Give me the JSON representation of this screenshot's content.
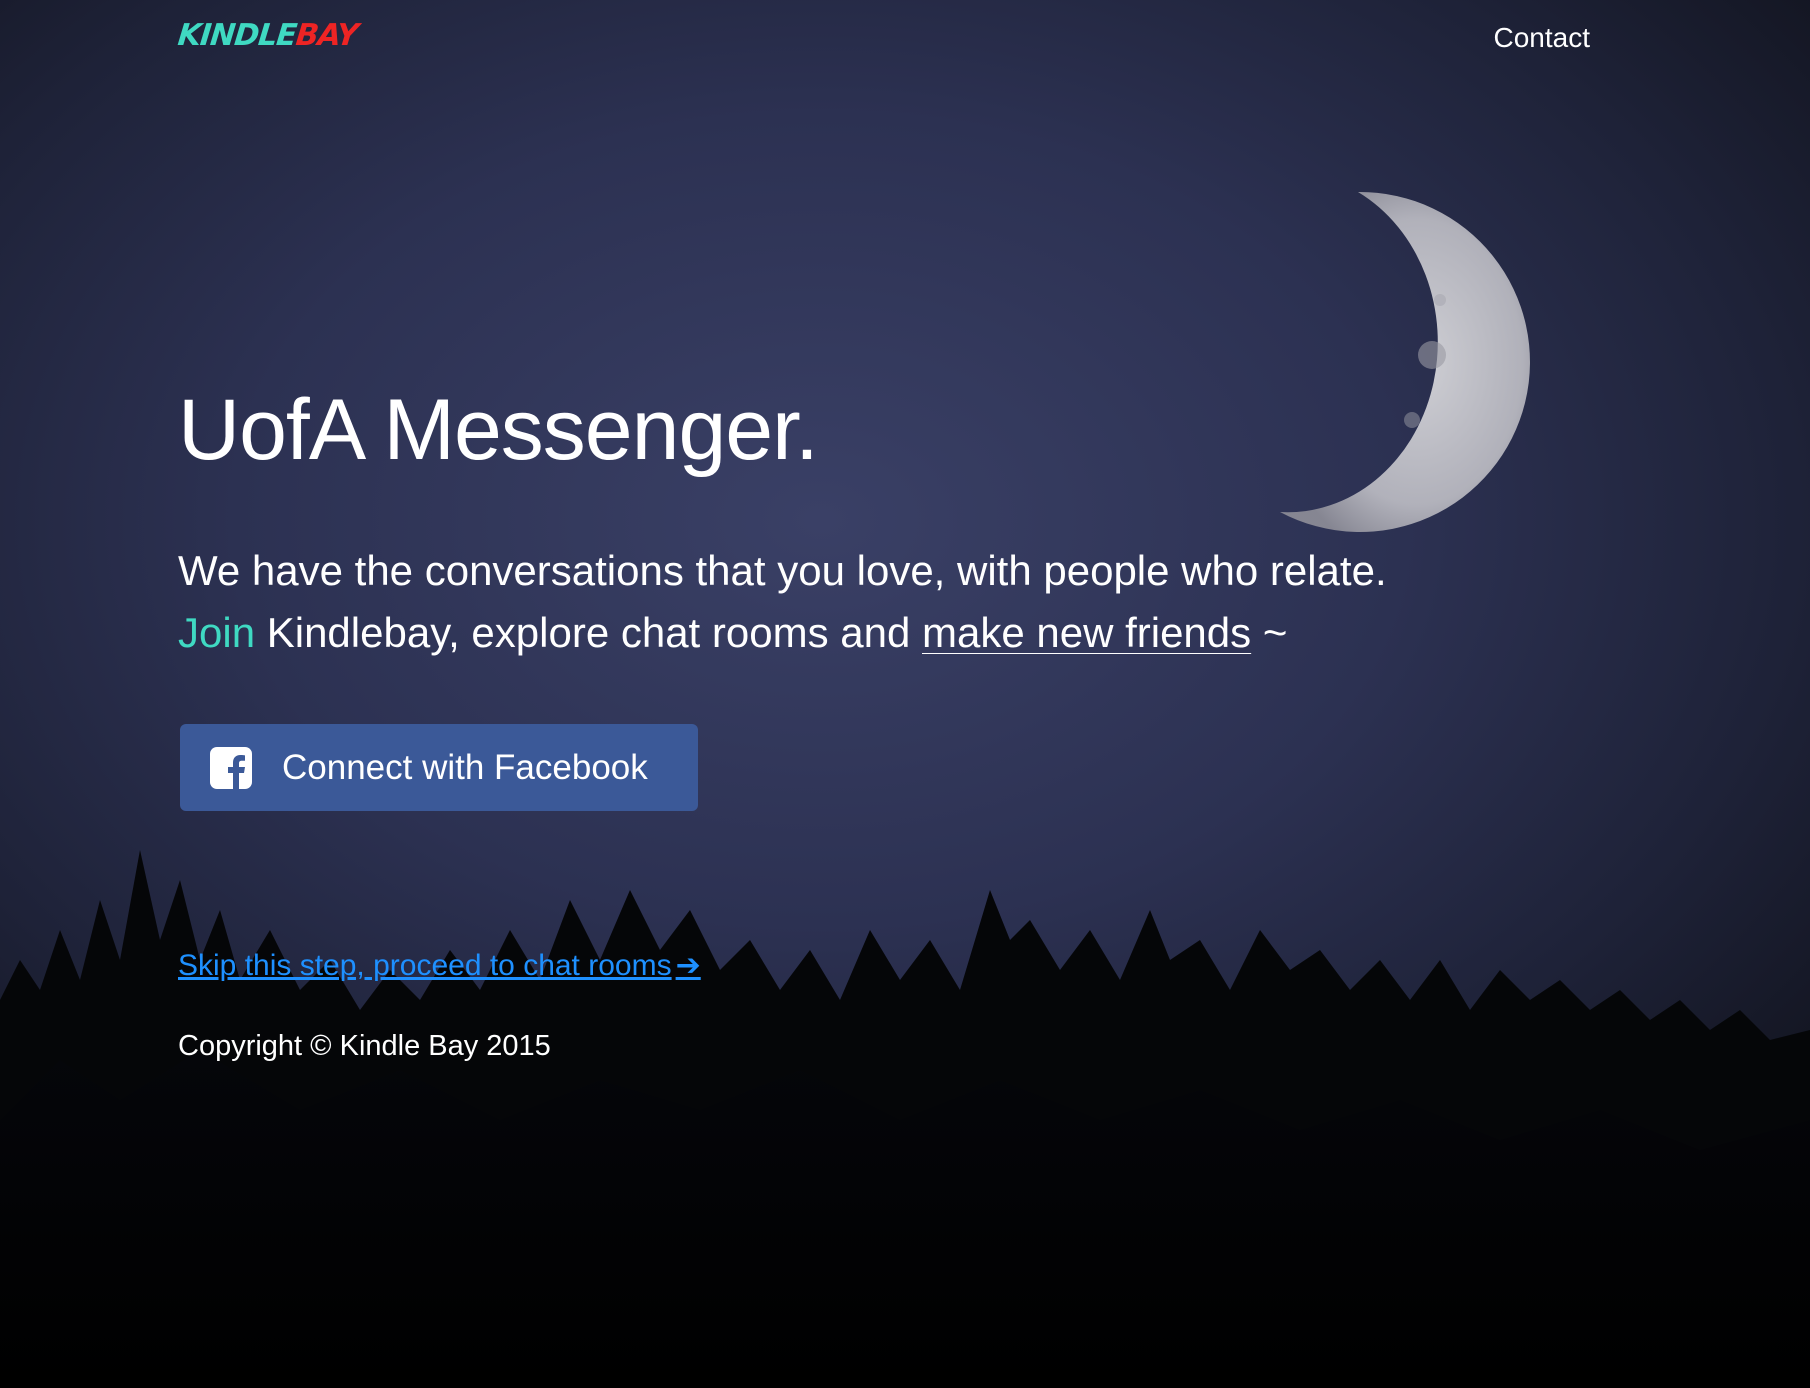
{
  "nav": {
    "logo_part1": "KINDLE",
    "logo_part2": "BAY",
    "contact_label": "Contact"
  },
  "hero": {
    "title": "UofA Messenger.",
    "tagline_line1": "We have the conversations that you love, with people who relate.",
    "tagline_join": "Join",
    "tagline_middle": " Kindlebay, explore chat rooms and ",
    "tagline_friends": "make new friends",
    "tagline_end": " ~"
  },
  "cta": {
    "facebook_label": "Connect with Facebook",
    "skip_label": "Skip this step, proceed to chat rooms",
    "skip_arrow": "➔"
  },
  "footer": {
    "copyright": "Copyright © Kindle Bay 2015"
  },
  "colors": {
    "accent_teal": "#3fd9c2",
    "logo_red": "#ee2424",
    "facebook_blue": "#3b5998",
    "link_blue": "#1e90ff",
    "sky_dark": "#2c3152"
  }
}
